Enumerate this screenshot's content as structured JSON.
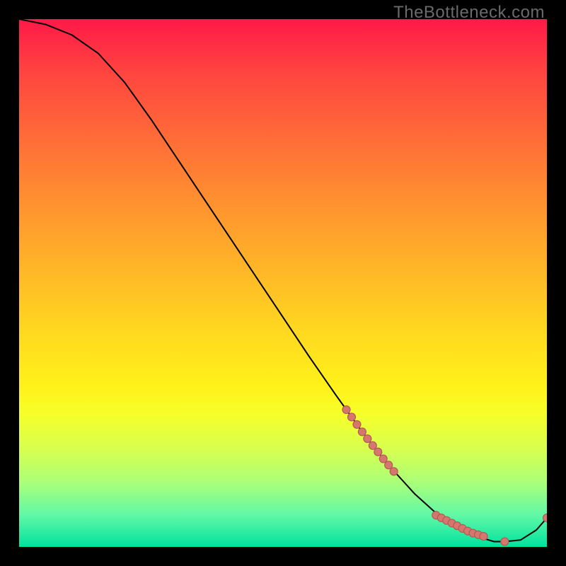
{
  "watermark": "TheBottleneck.com",
  "chart_data": {
    "type": "line",
    "title": "",
    "xlabel": "",
    "ylabel": "",
    "xlim": [
      0,
      100
    ],
    "ylim": [
      0,
      100
    ],
    "grid": false,
    "legend": false,
    "background_gradient": [
      "#ff1948",
      "#ffd520",
      "#fff31a",
      "#00e29e"
    ],
    "curve": {
      "name": "bottleneck-curve",
      "x": [
        0,
        5,
        10,
        15,
        20,
        25,
        30,
        35,
        40,
        45,
        50,
        55,
        60,
        62,
        65,
        70,
        75,
        80,
        85,
        90,
        92,
        95,
        98,
        100
      ],
      "y": [
        100,
        99,
        97,
        93.5,
        88,
        81,
        73.5,
        66,
        58.5,
        51,
        43.5,
        36,
        28.8,
        26,
        21.8,
        15.5,
        10,
        5.5,
        2.5,
        1,
        1,
        1.3,
        3.2,
        5.5
      ]
    },
    "dots": {
      "name": "highlight-points",
      "color": "#d6776f",
      "x": [
        62,
        63,
        64,
        65,
        66,
        67,
        68,
        69,
        70,
        71,
        79,
        80,
        81,
        82,
        83,
        84,
        85,
        86,
        87,
        88,
        92,
        100
      ],
      "y": [
        26,
        24.6,
        23.2,
        21.8,
        20.5,
        19.2,
        18,
        16.7,
        15.5,
        14.3,
        6,
        5.5,
        5,
        4.5,
        4,
        3.5,
        3,
        2.6,
        2.3,
        2,
        1,
        5.5
      ]
    }
  }
}
